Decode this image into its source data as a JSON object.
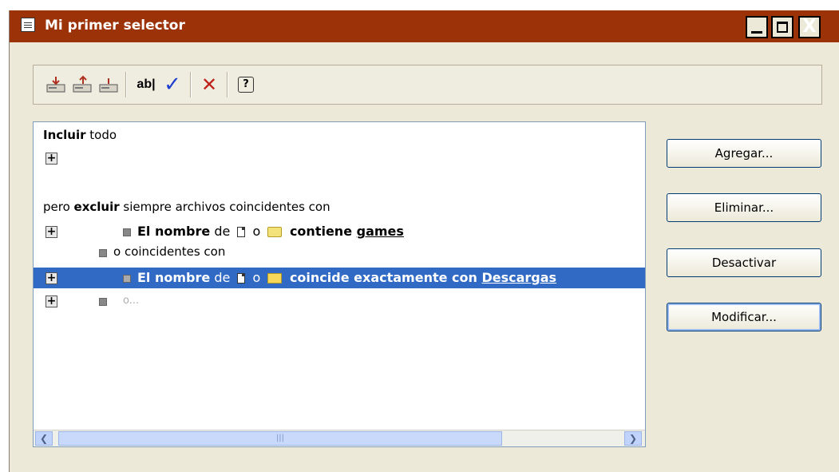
{
  "window": {
    "title": "Mi primer selector",
    "controls": {
      "minimize": "_",
      "maximize": "□",
      "close": "X"
    }
  },
  "toolbar": {
    "buttons": [
      {
        "icon": "drive-down-icon"
      },
      {
        "icon": "drive-up-icon"
      },
      {
        "icon": "drive-icon"
      },
      {
        "icon": "rename-ab-icon",
        "label": "ab|"
      },
      {
        "icon": "check-icon",
        "label": "✓"
      },
      {
        "icon": "delete-x-icon",
        "label": "✕"
      },
      {
        "icon": "help-icon",
        "label": "?"
      }
    ]
  },
  "tree": {
    "include_bold": "Incluir",
    "include_rest": " todo",
    "exclude_prefix": "pero ",
    "exclude_bold": "excluir",
    "exclude_rest": " siempre archivos coincidentes con",
    "rule1": {
      "name_bold": "El nombre",
      "de": " de ",
      "o": " o ",
      "contains_bold": " contiene ",
      "value": "games"
    },
    "rule_or": {
      "o": "o",
      "text": " coincidentes con"
    },
    "rule2": {
      "name_bold": "El nombre",
      "de": " de ",
      "o": " o ",
      "match_bold": " coincide exactamente con ",
      "value": "Descargas"
    },
    "placeholder": "o..."
  },
  "buttons": {
    "add": "Agregar...",
    "remove": "Eliminar...",
    "disable": "Desactivar",
    "modify": "Modificar..."
  },
  "colors": {
    "title_bar": "#9b3208",
    "selection": "#316ac5"
  }
}
